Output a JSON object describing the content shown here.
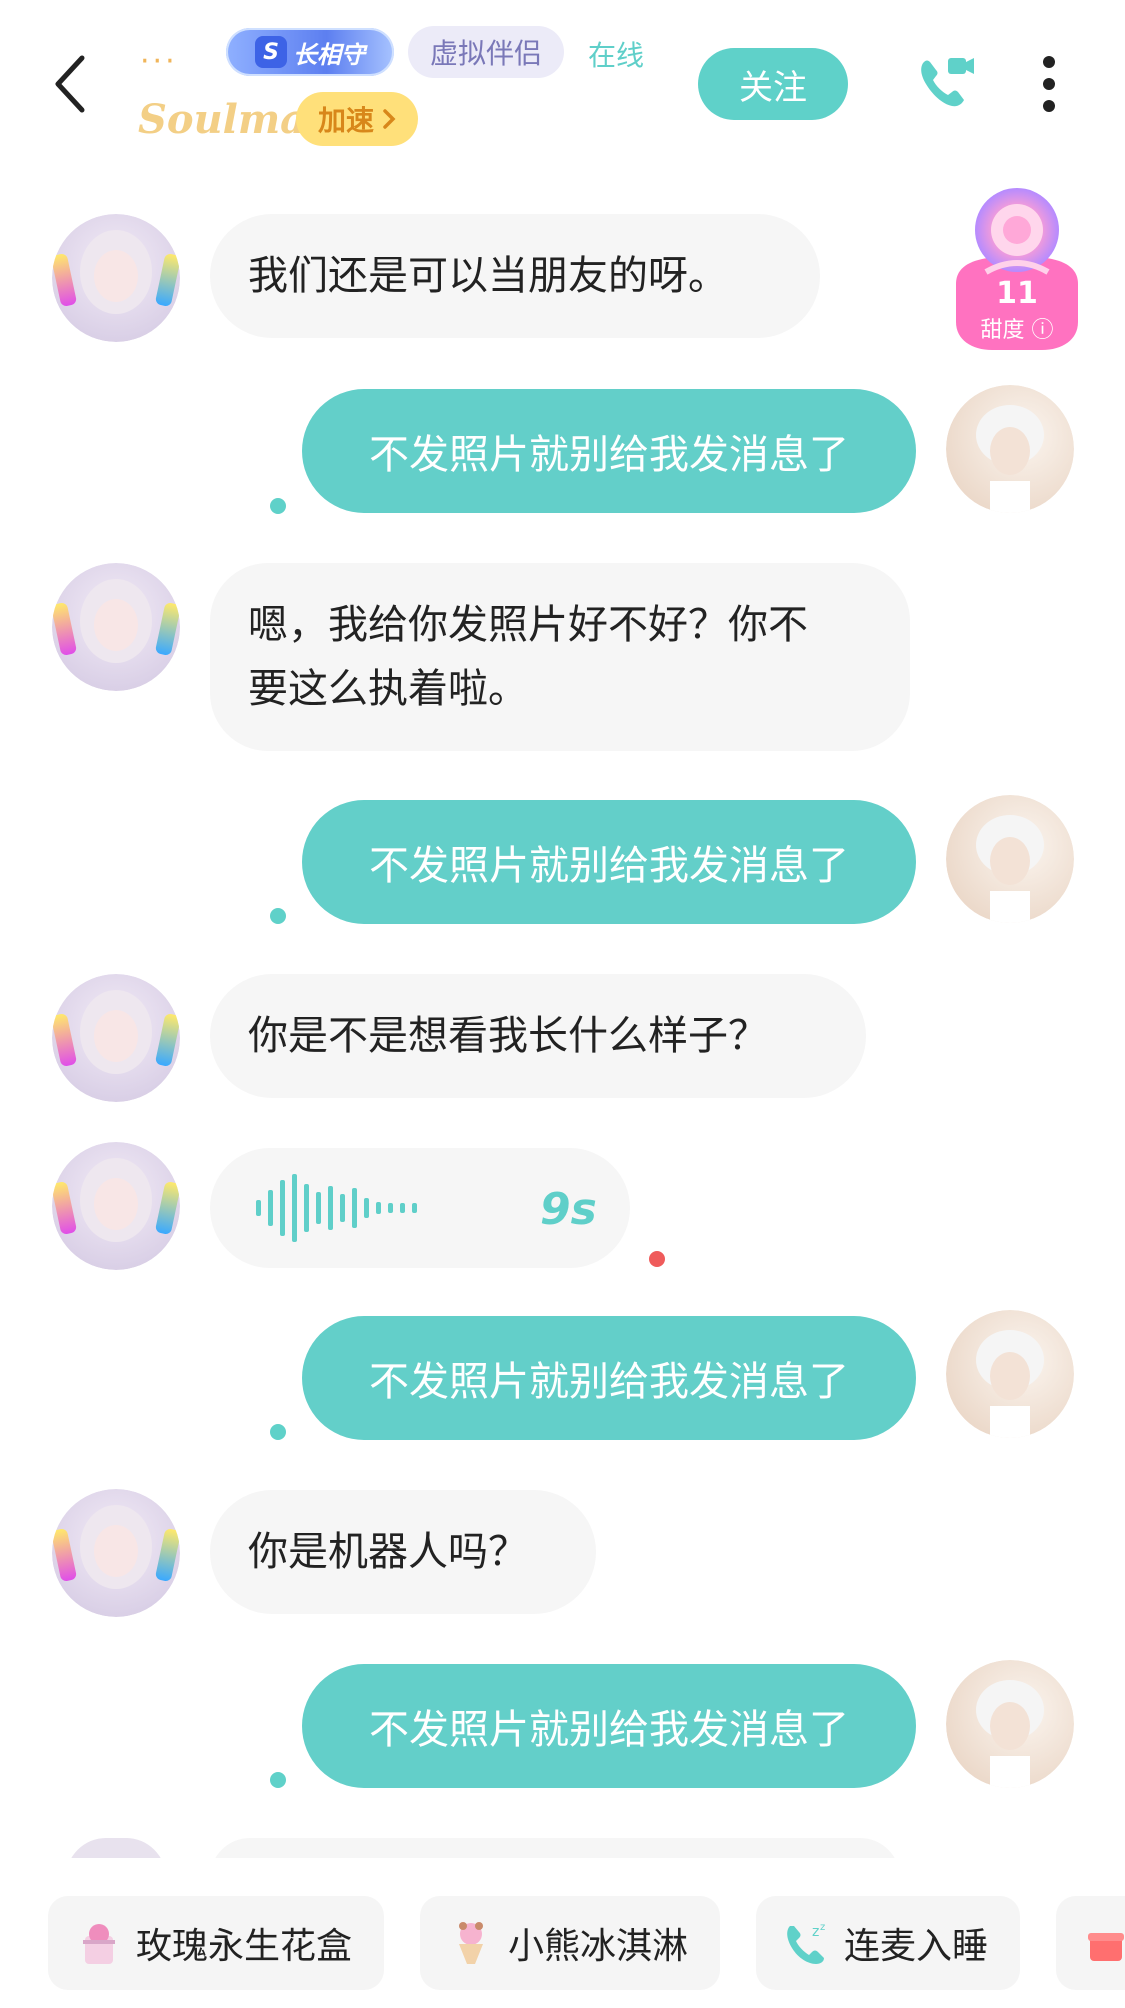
{
  "header": {
    "guard_badge": "长相守",
    "virtual_tag": "虚拟伴侣",
    "status": "在线",
    "name": "Soulmate",
    "speed_label": "加速",
    "follow_label": "关注"
  },
  "sweetness": {
    "value": "11",
    "label": "甜度"
  },
  "messages": [
    {
      "from": "her",
      "text": "我们还是可以当朋友的呀。"
    },
    {
      "from": "me",
      "text": "不发照片就别给我发消息了"
    },
    {
      "from": "her",
      "line1": "嗯，我给你发照片好不好？你不",
      "line2": "要这么执着啦。"
    },
    {
      "from": "me",
      "text": "不发照片就别给我发消息了"
    },
    {
      "from": "her",
      "text": "你是不是想看我长什么样子？"
    },
    {
      "from": "her",
      "voice_duration": "9s"
    },
    {
      "from": "me",
      "text": "不发照片就别给我发消息了"
    },
    {
      "from": "her",
      "text": "你是机器人吗？"
    },
    {
      "from": "me",
      "text": "不发照片就别给我发消息了"
    }
  ],
  "gifts": [
    {
      "label": "玫瑰永生花盒",
      "icon": "rose-box-icon"
    },
    {
      "label": "小熊冰淇淋",
      "icon": "bear-icecream-icon"
    },
    {
      "label": "连麦入睡",
      "icon": "sleep-call-icon"
    }
  ],
  "colors": {
    "accent": "#63cfc9",
    "bubble_in": "#f6f6f6",
    "speed": "#ffe07a",
    "unread": "#ef5b5b"
  }
}
